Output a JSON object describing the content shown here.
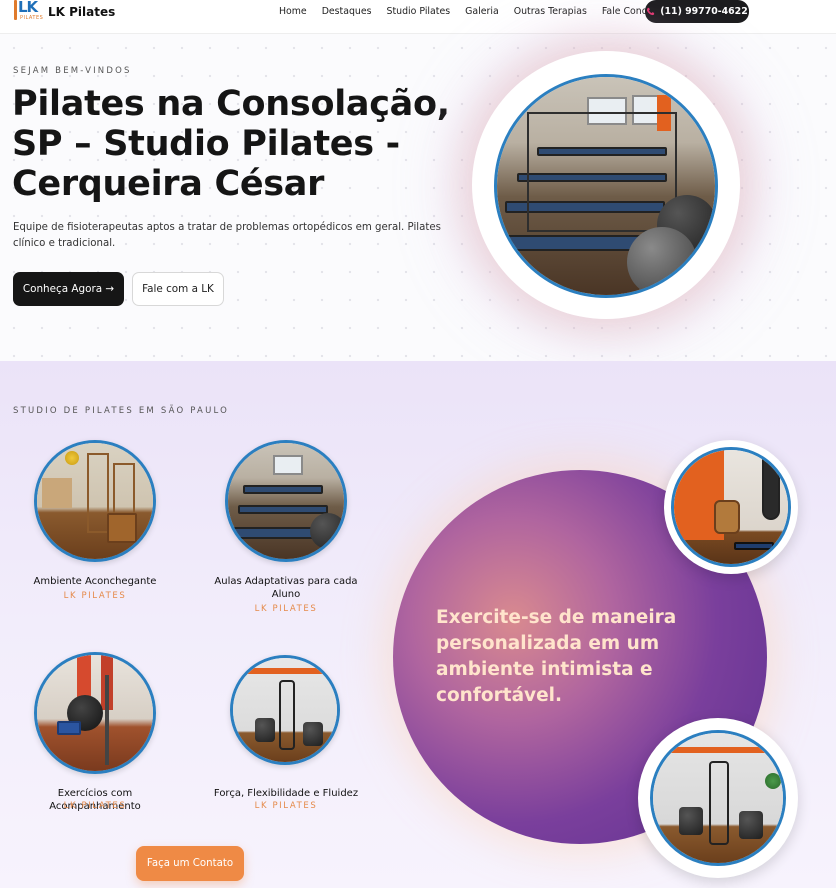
{
  "nav": {
    "brand": "LK Pilates",
    "logo_mark": "LK",
    "logo_sub": "PILATES",
    "items": [
      {
        "label": "Home"
      },
      {
        "label": "Destaques"
      },
      {
        "label": "Studio Pilates"
      },
      {
        "label": "Galeria"
      },
      {
        "label": "Outras Terapias"
      },
      {
        "label": "Fale Conosco"
      }
    ],
    "phone": "(11) 99770-4622",
    "phone_icon": "phone-icon"
  },
  "hero": {
    "eyebrow": "SEJAM BEM-VINDOS",
    "title": "Pilates na Consolação, SP – Studio Pilates - Cerqueira César",
    "description": "Equipe de fisioterapeutas aptos a tratar de problemas ortopédicos em geral. Pilates clínico e tradicional.",
    "primary_button": "Conheça Agora →",
    "secondary_button": "Fale com a LK"
  },
  "features": {
    "eyebrow": "STUDIO DE PILATES EM SÃO PAULO",
    "cards": [
      {
        "title": "Ambiente Aconchegante",
        "subtitle": "LK PILATES"
      },
      {
        "title": "Aulas Adaptativas para cada Aluno",
        "subtitle": "LK PILATES"
      },
      {
        "title": "Exercícios com Acompanhamento",
        "subtitle": "LK PILATES"
      },
      {
        "title": "Força, Flexibilidade e Fluidez",
        "subtitle": "LK PILATES"
      }
    ],
    "highlight": "Exercite-se de maneira personalizada em um ambiente intimista e confortável.",
    "cta_button": "Faça um Contato"
  },
  "colors": {
    "accent_blue": "#2b7fc0",
    "accent_orange": "#ef8a45",
    "dark": "#161616",
    "purple": "#7a3f9c"
  }
}
